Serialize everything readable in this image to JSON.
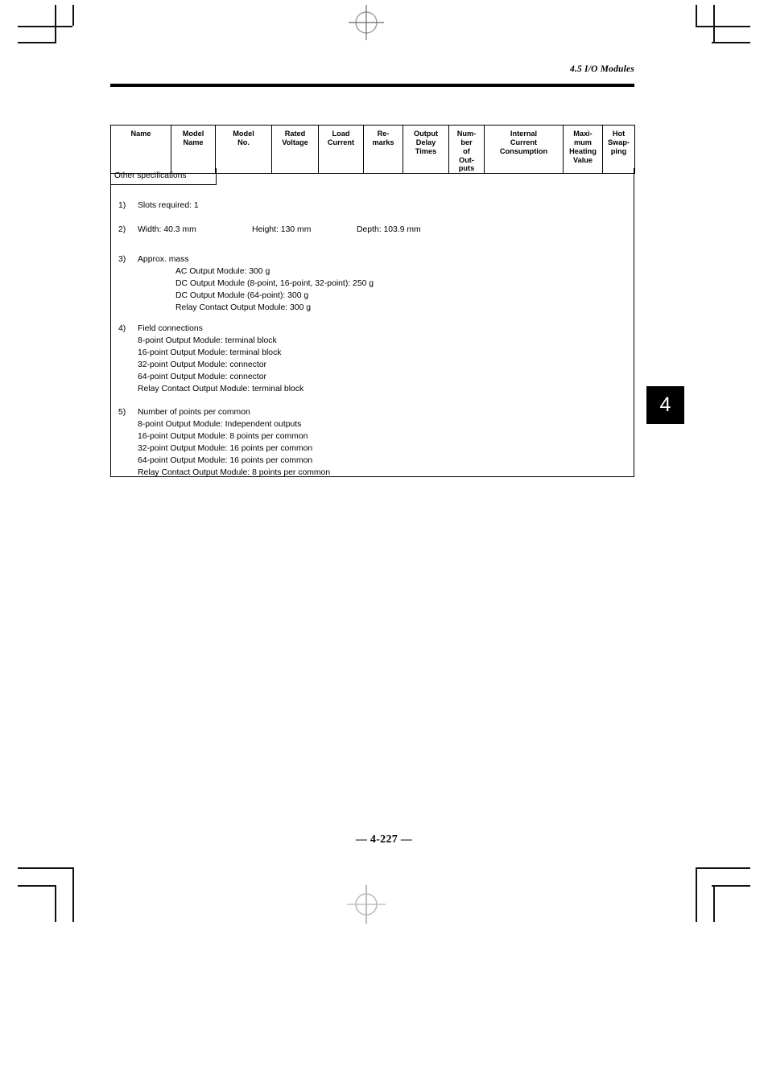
{
  "page": {
    "running_head": "4.5 I/O Modules",
    "page_number": "— 4-227 —",
    "chapter_tab": "4"
  },
  "table": {
    "columns": [
      "Name",
      "Model Name",
      "Model No.",
      "Rated Voltage",
      "Load Current",
      "Re- marks",
      "Output Delay Times",
      "Num- ber of Out- puts",
      "Internal Current Consumption",
      "Maxi- mum Heating Value",
      "Hot Swap- ping"
    ],
    "other_spec_label": "Other specifications"
  },
  "specs": {
    "item1": {
      "number": "1)",
      "heading": "Slots required: 1"
    },
    "item2": {
      "number": "2)",
      "width": "Width: 40.3 mm",
      "height": "Height: 130 mm",
      "depth": "Depth: 103.9 mm"
    },
    "item3": {
      "number": "3)",
      "heading": "Approx. mass",
      "lines": [
        "AC Output Module: 300 g",
        "DC Output Module (8-point, 16-point, 32-point): 250 g",
        "DC Output Module (64-point): 300 g",
        "Relay Contact Output Module: 300 g"
      ]
    },
    "item4": {
      "number": "4)",
      "heading": "Field connections",
      "lines": [
        "8-point Output Module: terminal block",
        "16-point Output Module: terminal block",
        "32-point Output Module: connector",
        "64-point Output Module: connector",
        "Relay Contact Output Module: terminal block"
      ]
    },
    "item5": {
      "number": "5)",
      "heading": "Number of points per common",
      "lines": [
        "8-point Output Module: Independent outputs",
        "16-point Output Module: 8 points per common",
        "32-point Output Module: 16 points per common",
        "64-point Output Module: 16 points per common",
        "Relay Contact Output Module: 8 points per common"
      ]
    }
  }
}
